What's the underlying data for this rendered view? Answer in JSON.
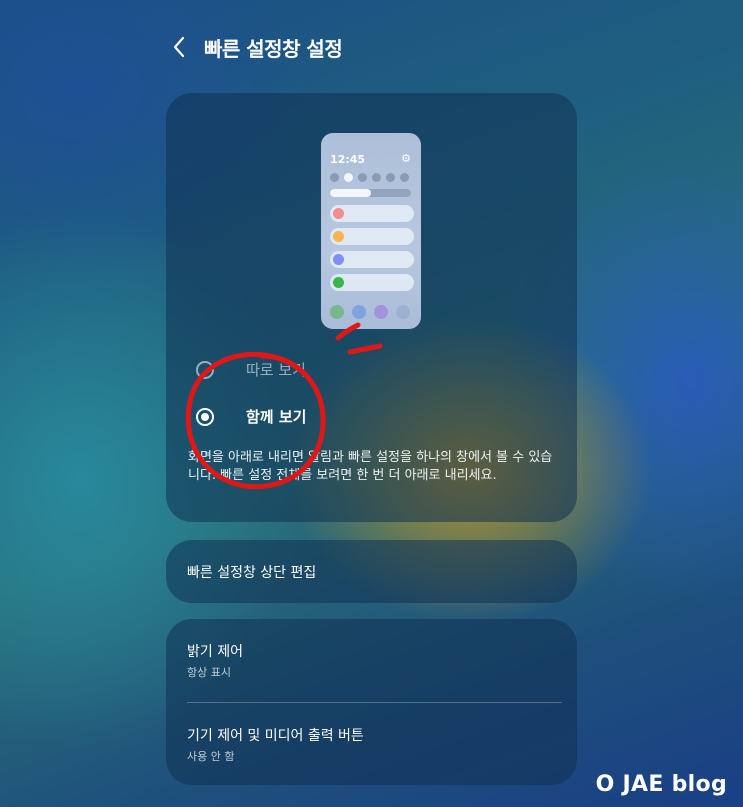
{
  "header": {
    "title": "빠른 설정창 설정",
    "back_icon": "chevron-left-icon"
  },
  "preview": {
    "time": "12:45",
    "gear_icon": "gear-icon",
    "brightness_level": 0.5,
    "notification_colors": [
      "#ef8f8f",
      "#f5b64f",
      "#7f8ff2",
      "#3ab54a"
    ]
  },
  "options": [
    {
      "label": "따로 보기",
      "selected": false
    },
    {
      "label": "함께 보기",
      "selected": true
    }
  ],
  "description": "화면을 아래로 내리면 알림과 빠른 설정을 하나의 창에서 볼 수 있습니다. 빠른 설정 전체를 보려면 한 번 더 아래로 내리세요.",
  "edit_top": {
    "label": "빠른 설정창 상단 편집"
  },
  "settings": [
    {
      "title": "밝기 제어",
      "subtitle": "항상 표시"
    },
    {
      "title": "기기 제어 및 미디어 출력 버튼",
      "subtitle": "사용 안 함"
    }
  ],
  "annotation_color": "#e01717",
  "watermark": "O JAE blog"
}
